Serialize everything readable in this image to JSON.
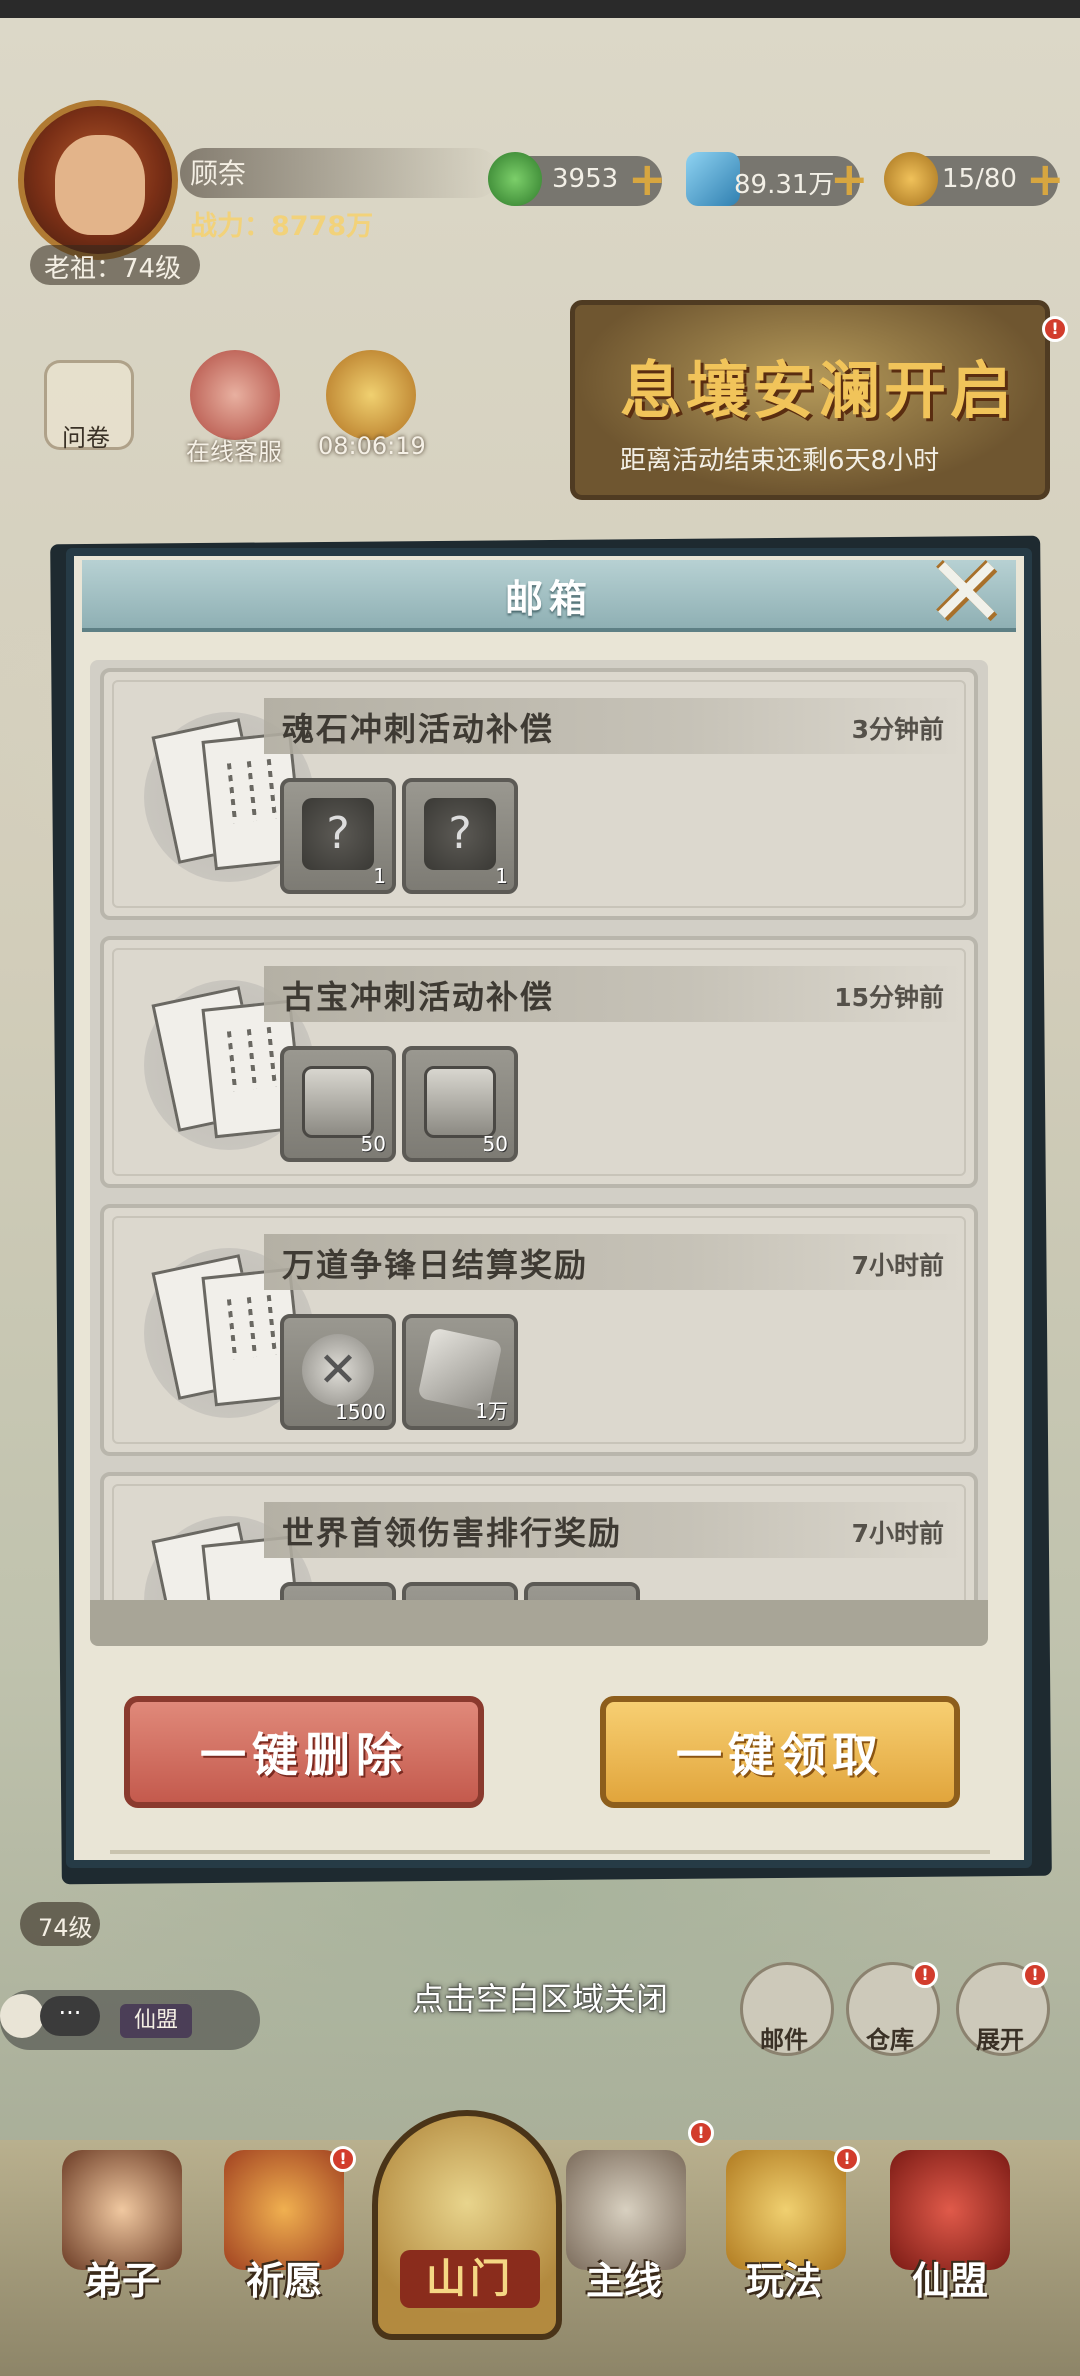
{
  "player": {
    "name": "顾奈",
    "power": "战力：8778万",
    "level": "老祖：74级"
  },
  "resources": [
    {
      "icon": "jade-coin-icon",
      "value": "3953"
    },
    {
      "icon": "spirit-stone-icon",
      "value": "89.31万"
    },
    {
      "icon": "money-bag-icon",
      "value": "15/80"
    }
  ],
  "side_menu": {
    "survey": "问卷",
    "online_service": "在线客服",
    "timer": "08:06:19"
  },
  "event_banner": {
    "title": "息壤安澜开启",
    "subtitle": "距离活动结束还剩6天8小时"
  },
  "mailbox": {
    "title": "邮箱",
    "mails": [
      {
        "title": "魂石冲刺活动补偿",
        "time": "3分钟前",
        "rewards": [
          {
            "icon": "mystery-chest-icon",
            "count": "1"
          },
          {
            "icon": "mystery-chest-icon",
            "count": "1"
          }
        ]
      },
      {
        "title": "古宝冲刺活动补偿",
        "time": "15分钟前",
        "rewards": [
          {
            "icon": "treasure-box-icon",
            "count": "50"
          },
          {
            "icon": "treasure-box-icon",
            "count": "50"
          }
        ]
      },
      {
        "title": "万道争锋日结算奖励",
        "time": "7小时前",
        "rewards": [
          {
            "icon": "crossed-swords-token-icon",
            "count": "1500"
          },
          {
            "icon": "spirit-stone-icon",
            "count": "1万"
          }
        ]
      },
      {
        "title": "世界首领伤害排行奖励",
        "time": "7小时前",
        "rewards": []
      }
    ],
    "delete_all_label": "一键删除",
    "claim_all_label": "一键领取"
  },
  "hint": "点击空白区域关闭",
  "bottom_level": "74级",
  "chat": {
    "dots": "···",
    "channel": "仙盟"
  },
  "quick_buttons": {
    "mail": "邮件",
    "warehouse": "仓库",
    "expand": "展开"
  },
  "nav": {
    "disciples": "弟子",
    "wish": "祈愿",
    "sect_gate": "山门",
    "main_quest": "主线",
    "gameplay": "玩法",
    "alliance": "仙盟"
  },
  "colors": {
    "dialog_header": "#9dbcc0",
    "delete_button": "#d27162",
    "claim_button": "#efbe58",
    "notification": "#d23c2c"
  }
}
